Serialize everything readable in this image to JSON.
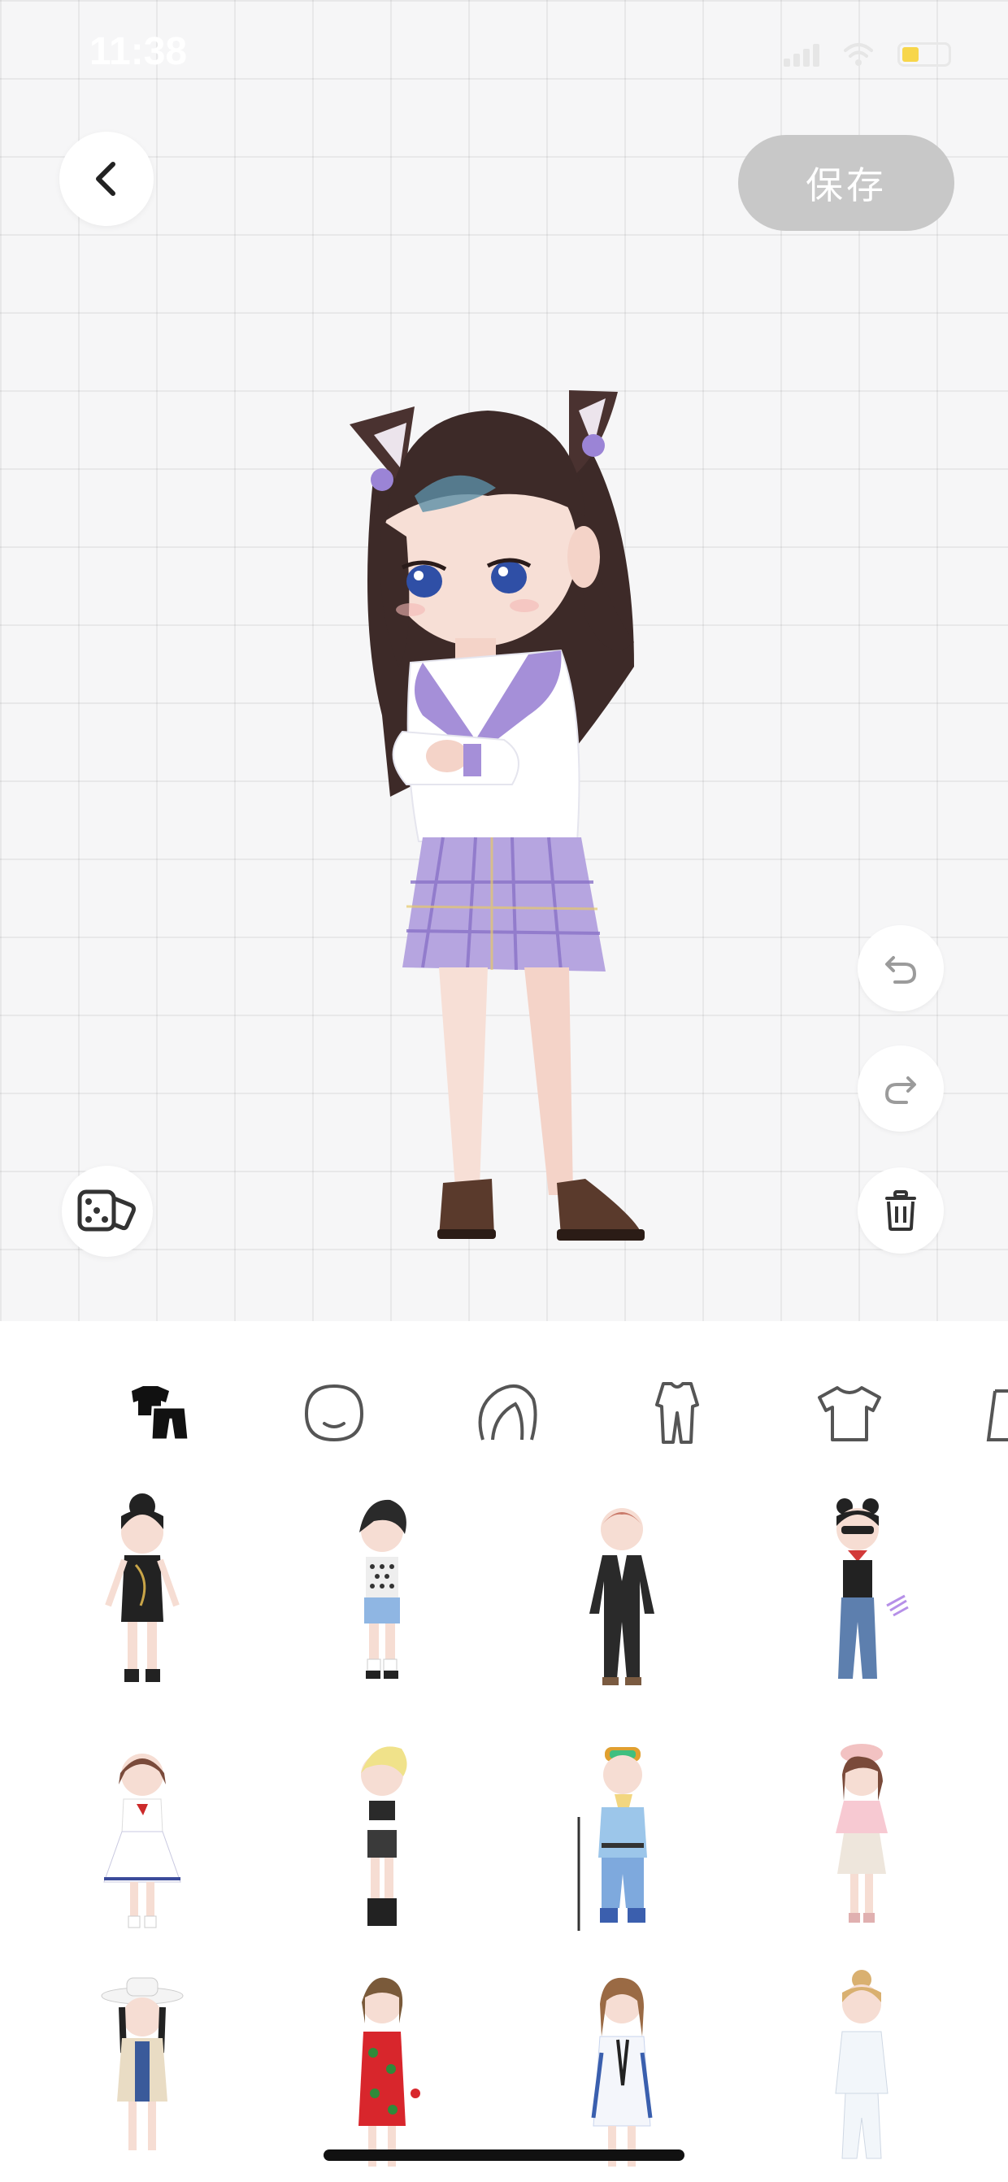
{
  "status_bar": {
    "time": "11:38"
  },
  "toolbar": {
    "save_label": "保存",
    "back_icon": "chevron-left-icon",
    "undo_icon": "undo-icon",
    "redo_icon": "redo-icon",
    "delete_icon": "trash-icon",
    "random_icon": "dice-icon"
  },
  "category_tabs": [
    {
      "name": "outfit",
      "icon": "outfit-icon",
      "selected": true
    },
    {
      "name": "face",
      "icon": "face-icon",
      "selected": false
    },
    {
      "name": "hair",
      "icon": "hair-icon",
      "selected": false
    },
    {
      "name": "full-body",
      "icon": "jumpsuit-icon",
      "selected": false
    },
    {
      "name": "top",
      "icon": "tshirt-icon",
      "selected": false
    },
    {
      "name": "more",
      "icon": "clothing-icon",
      "selected": false
    }
  ],
  "colors": {
    "accent_purple": "#a58fd8",
    "save_button_bg": "#c8c8c8",
    "selected_tab": "#111111",
    "unselected_tab": "#555555"
  }
}
